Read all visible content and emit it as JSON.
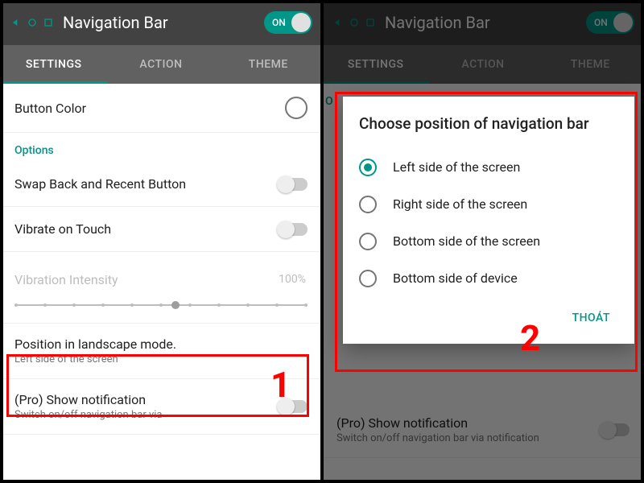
{
  "app": {
    "title": "Navigation Bar",
    "toggle_label": "ON"
  },
  "tabs": {
    "settings": "SETTINGS",
    "action": "ACTION",
    "theme": "THEME"
  },
  "left": {
    "button_color": "Button Color",
    "options_header": "Options",
    "swap": "Swap Back and Recent Button",
    "vibrate": "Vibrate on Touch",
    "vibration_intensity": "Vibration Intensity",
    "vibration_value": "100%",
    "position_title": "Position in landscape mode.",
    "position_sub": "Left side of the screen",
    "pro_notif": "(Pro) Show notification",
    "pro_notif_sub": "Switch on/off navigation bar via"
  },
  "right": {
    "options_initial": "O",
    "pro_notif": "(Pro) Show notification",
    "pro_notif_sub": "Switch on/off navigation bar via notification"
  },
  "dialog": {
    "title": "Choose position of navigation bar",
    "opt1": "Left side of the screen",
    "opt2": "Right side of the screen",
    "opt3": "Bottom side of the screen",
    "opt4": "Bottom side of device",
    "exit": "THOÁT"
  },
  "steps": {
    "one": "1",
    "two": "2"
  }
}
